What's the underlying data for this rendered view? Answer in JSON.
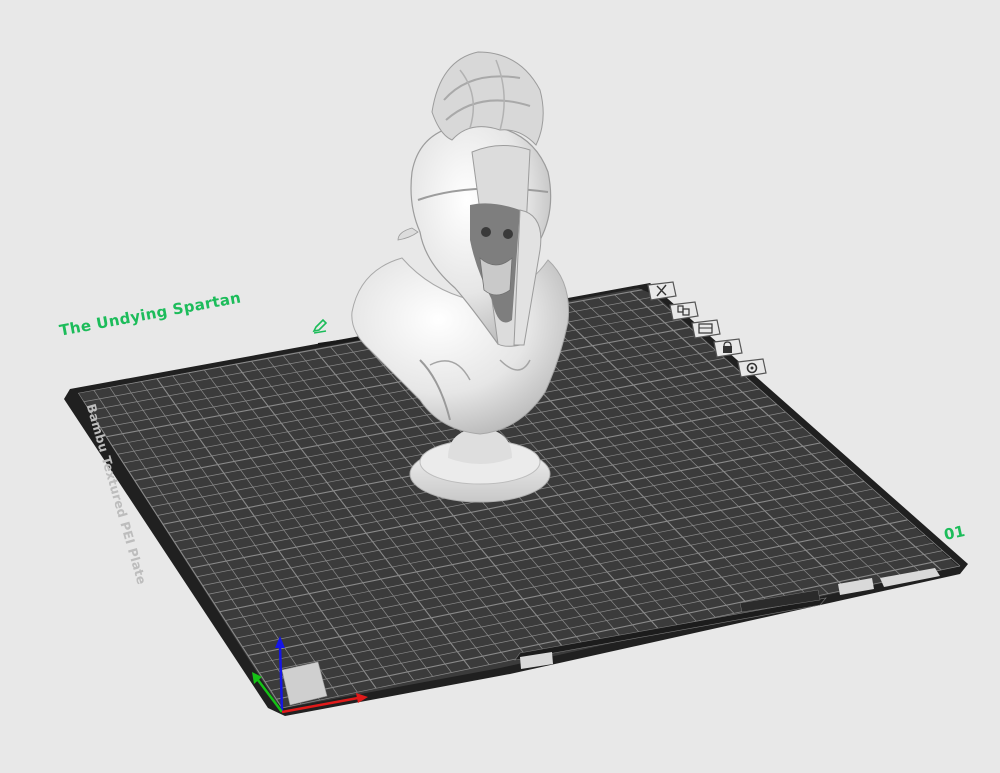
{
  "plate": {
    "name": "The Undying Spartan",
    "number": "01",
    "bed_type": "Bambu Textured PEI Plate"
  },
  "plate_toolbar": [
    {
      "id": "remove",
      "icon": "close-icon"
    },
    {
      "id": "arrange",
      "icon": "arrange-icon"
    },
    {
      "id": "orient",
      "icon": "orient-icon"
    },
    {
      "id": "lock",
      "icon": "lock-icon"
    },
    {
      "id": "settings",
      "icon": "gear-icon"
    }
  ],
  "colors": {
    "background": "#e8e8e8",
    "bed": "#3b3b3b",
    "bed_border": "#202020",
    "grid": "#8a8a8a",
    "accent": "#1cbc5a",
    "axis_x": "#e01a1a",
    "axis_y": "#16c116",
    "axis_z": "#1515e8",
    "model": "#ececec"
  }
}
